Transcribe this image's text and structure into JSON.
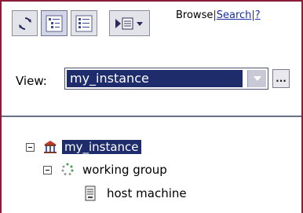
{
  "toolbar": {
    "buttons": [
      {
        "icon": "refresh-icon",
        "pressed": false
      },
      {
        "icon": "tree-view-icon",
        "pressed": true
      },
      {
        "icon": "list-view-icon",
        "pressed": false
      },
      {
        "icon": "view-menu-icon",
        "pressed": false
      }
    ]
  },
  "links": {
    "browse": "Browse",
    "sep1": "|",
    "search": "Search",
    "sep2": "|",
    "help": "?"
  },
  "view": {
    "label": "View:",
    "selected": "my_instance",
    "more_button": "..."
  },
  "tree": [
    {
      "label": "my_instance",
      "icon": "instance-icon",
      "expanded": true,
      "selected": true
    },
    {
      "label": "working group",
      "icon": "group-icon",
      "expanded": true,
      "selected": false
    },
    {
      "label": "host machine",
      "icon": "host-icon",
      "selected": false
    }
  ],
  "colors": {
    "frame": "#8c1d3a",
    "selection": "#1f2c6c",
    "link": "#1a2fa6"
  }
}
